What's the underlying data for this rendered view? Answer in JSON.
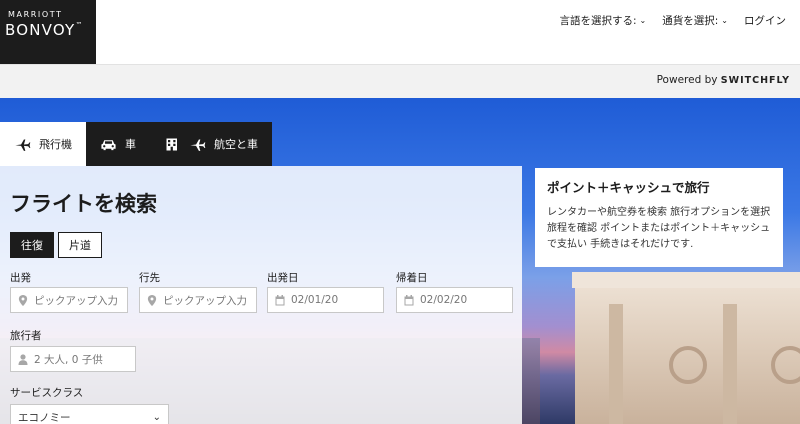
{
  "brand": {
    "top": "MARRIOTT",
    "main": "BONVOY",
    "tm": "™"
  },
  "nav": {
    "language": "言語を選択する:",
    "currency": "通貨を選択:",
    "login": "ログイン",
    "caret": "⌄"
  },
  "powered": {
    "prefix": "Powered by",
    "brand": "SWITCHFLY"
  },
  "tabs": [
    {
      "label": "飛行機",
      "icon": "plane-icon"
    },
    {
      "label": "車",
      "icon": "car-icon"
    },
    {
      "label": "航空と車",
      "icon": "building-plane-icon"
    }
  ],
  "search": {
    "title": "フライトを検索",
    "trip_types": {
      "round": "往復",
      "oneway": "片道"
    },
    "origin": {
      "label": "出発",
      "placeholder": "ピックアップ入力"
    },
    "destination": {
      "label": "行先",
      "placeholder": "ピックアップ入力"
    },
    "depart": {
      "label": "出発日",
      "value": "02/01/20"
    },
    "return": {
      "label": "帰着日",
      "value": "02/02/20"
    },
    "travelers": {
      "label": "旅行者",
      "value": "2 大人, 0 子供"
    },
    "cabin": {
      "label": "サービスクラス",
      "value": "エコノミー"
    }
  },
  "promo": {
    "title": "ポイント＋キャッシュで旅行",
    "body": "レンタカーや航空券を検索 旅行オプションを選択 旅程を確認 ポイントまたはポイント＋キャッシュで支払い 手続きはそれだけです."
  },
  "colors": {
    "accent": "#1c1c1c",
    "sky": "#2f6ee0"
  }
}
